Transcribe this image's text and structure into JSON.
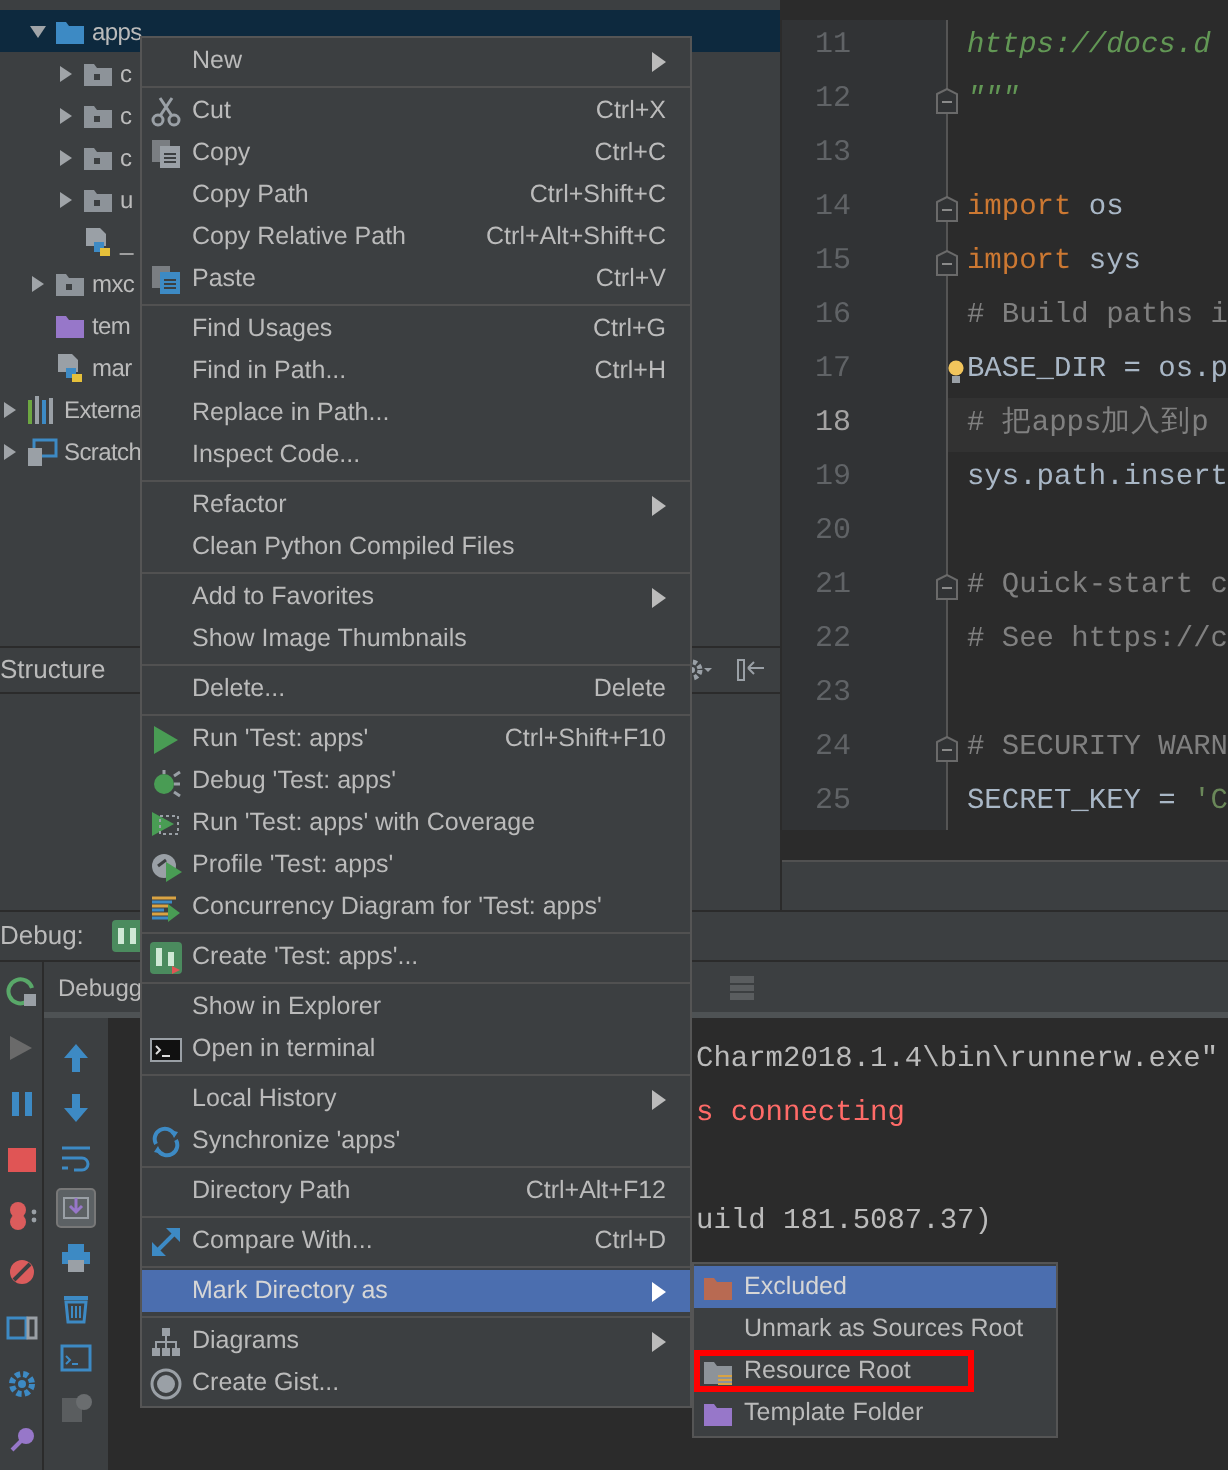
{
  "project_tree": {
    "items": [
      {
        "label": "apps",
        "kind": "source_folder",
        "expanded": true,
        "selected": true,
        "children": [
          {
            "label": "c",
            "kind": "folder",
            "expanded": false,
            "selected": false
          },
          {
            "label": "c",
            "kind": "folder",
            "expanded": false,
            "selected": false
          },
          {
            "label": "c",
            "kind": "folder",
            "expanded": false,
            "selected": false
          },
          {
            "label": "u",
            "kind": "folder",
            "expanded": false,
            "selected": false
          },
          {
            "label": "_",
            "kind": "python",
            "selected": false
          }
        ]
      },
      {
        "label": "mxc",
        "kind": "folder",
        "expanded": false,
        "selected": false
      },
      {
        "label": "tem",
        "kind": "template_folder",
        "selected": false
      },
      {
        "label": "mar",
        "kind": "python",
        "selected": false
      }
    ],
    "external_items": [
      {
        "label": "Externa",
        "kind": "library",
        "expanded": false,
        "selected": false
      },
      {
        "label": "Scratch",
        "kind": "scratch",
        "expanded": false,
        "selected": false
      }
    ]
  },
  "structure_panel": {
    "title": "Structure"
  },
  "editor": {
    "lines": [
      {
        "number": "11",
        "current": false,
        "fold_marker": false,
        "segments": [
          {
            "kind": "docstring",
            "text": "https://docs.d"
          }
        ]
      },
      {
        "number": "12",
        "current": false,
        "fold_marker": true,
        "segments": [
          {
            "kind": "docstring",
            "text": "\"\"\""
          }
        ]
      },
      {
        "number": "13",
        "current": false,
        "fold_marker": false
      },
      {
        "number": "14",
        "current": false,
        "fold_marker": true,
        "segments": [
          {
            "kind": "keyword",
            "text": "import "
          },
          {
            "kind": "plain",
            "text": "os"
          }
        ]
      },
      {
        "number": "15",
        "current": false,
        "fold_marker": true,
        "segments": [
          {
            "kind": "keyword",
            "text": "import "
          },
          {
            "kind": "plain",
            "text": "sys"
          }
        ]
      },
      {
        "number": "16",
        "current": false,
        "fold_marker": false,
        "segments": [
          {
            "kind": "comment",
            "text": "# Build paths i"
          }
        ]
      },
      {
        "number": "17",
        "current": false,
        "fold_marker": false,
        "segments": [
          {
            "kind": "plain",
            "text": "BASE_DIR = os.p"
          }
        ]
      },
      {
        "number": "18",
        "current": true,
        "fold_marker": false,
        "segments": [
          {
            "kind": "comment",
            "text": "# 把apps加入到p"
          }
        ]
      },
      {
        "number": "19",
        "current": false,
        "fold_marker": false,
        "segments": [
          {
            "kind": "plain",
            "text": "sys.path.insert"
          }
        ]
      },
      {
        "number": "20",
        "current": false,
        "fold_marker": false
      },
      {
        "number": "21",
        "current": false,
        "fold_marker": true,
        "segments": [
          {
            "kind": "comment",
            "text": "# Quick-start c"
          }
        ]
      },
      {
        "number": "22",
        "current": false,
        "fold_marker": false,
        "segments": [
          {
            "kind": "comment",
            "text": "# See https://c"
          }
        ]
      },
      {
        "number": "23",
        "current": false,
        "fold_marker": false
      },
      {
        "number": "24",
        "current": false,
        "fold_marker": true,
        "segments": [
          {
            "kind": "comment",
            "text": "# SECURITY WARN"
          }
        ]
      },
      {
        "number": "25",
        "current": false,
        "fold_marker": false,
        "segments": [
          {
            "kind": "plain",
            "text": "SECRET_KEY = "
          },
          {
            "kind": "string",
            "text": "'C"
          }
        ]
      }
    ]
  },
  "debug_panel": {
    "title": "Debug:",
    "tab": "Debugg",
    "console_lines": [
      {
        "kind": "plain",
        "text": "Charm2018.1.4\\bin\\runnerw.exe\""
      },
      {
        "kind": "error",
        "text": "s connecting"
      },
      {
        "kind": "blank"
      },
      {
        "kind": "plain",
        "text": "uild 181.5087.37)"
      }
    ]
  },
  "context_menu": {
    "items": [
      {
        "kind": "item",
        "label": "New",
        "submenu": true,
        "selected": false
      },
      {
        "kind": "separator"
      },
      {
        "kind": "item",
        "label": "Cut",
        "shortcut": "Ctrl+X",
        "submenu": false,
        "selected": false
      },
      {
        "kind": "item",
        "label": "Copy",
        "shortcut": "Ctrl+C",
        "submenu": false,
        "selected": false
      },
      {
        "kind": "item",
        "label": "Copy Path",
        "shortcut": "Ctrl+Shift+C",
        "submenu": false,
        "selected": false
      },
      {
        "kind": "item",
        "label": "Copy Relative Path",
        "shortcut": "Ctrl+Alt+Shift+C",
        "submenu": false,
        "selected": false
      },
      {
        "kind": "item",
        "label": "Paste",
        "shortcut": "Ctrl+V",
        "submenu": false,
        "selected": false
      },
      {
        "kind": "separator"
      },
      {
        "kind": "item",
        "label": "Find Usages",
        "shortcut": "Ctrl+G",
        "submenu": false,
        "selected": false
      },
      {
        "kind": "item",
        "label": "Find in Path...",
        "shortcut": "Ctrl+H",
        "submenu": false,
        "selected": false
      },
      {
        "kind": "item",
        "label": "Replace in Path...",
        "submenu": false,
        "selected": false
      },
      {
        "kind": "item",
        "label": "Inspect Code...",
        "submenu": false,
        "selected": false
      },
      {
        "kind": "separator"
      },
      {
        "kind": "item",
        "label": "Refactor",
        "submenu": true,
        "selected": false
      },
      {
        "kind": "item",
        "label": "Clean Python Compiled Files",
        "submenu": false,
        "selected": false
      },
      {
        "kind": "separator"
      },
      {
        "kind": "item",
        "label": "Add to Favorites",
        "submenu": true,
        "selected": false
      },
      {
        "kind": "item",
        "label": "Show Image Thumbnails",
        "submenu": false,
        "selected": false
      },
      {
        "kind": "separator"
      },
      {
        "kind": "item",
        "label": "Delete...",
        "shortcut": "Delete",
        "submenu": false,
        "selected": false
      },
      {
        "kind": "separator"
      },
      {
        "kind": "item",
        "label": "Run 'Test: apps'",
        "shortcut": "Ctrl+Shift+F10",
        "submenu": false,
        "selected": false
      },
      {
        "kind": "item",
        "label": "Debug 'Test: apps'",
        "submenu": false,
        "selected": false
      },
      {
        "kind": "item",
        "label": "Run 'Test: apps' with Coverage",
        "submenu": false,
        "selected": false
      },
      {
        "kind": "item",
        "label": "Profile 'Test: apps'",
        "submenu": false,
        "selected": false
      },
      {
        "kind": "item",
        "label": "Concurrency Diagram for 'Test: apps'",
        "submenu": false,
        "selected": false
      },
      {
        "kind": "separator"
      },
      {
        "kind": "item",
        "label": "Create 'Test: apps'...",
        "submenu": false,
        "selected": false
      },
      {
        "kind": "separator"
      },
      {
        "kind": "item",
        "label": "Show in Explorer",
        "submenu": false,
        "selected": false
      },
      {
        "kind": "item",
        "label": "Open in terminal",
        "submenu": false,
        "selected": false
      },
      {
        "kind": "separator"
      },
      {
        "kind": "item",
        "label": "Local History",
        "submenu": true,
        "selected": false
      },
      {
        "kind": "item",
        "label": "Synchronize 'apps'",
        "submenu": false,
        "selected": false
      },
      {
        "kind": "separator"
      },
      {
        "kind": "item",
        "label": "Directory Path",
        "shortcut": "Ctrl+Alt+F12",
        "submenu": false,
        "selected": false
      },
      {
        "kind": "separator"
      },
      {
        "kind": "item",
        "label": "Compare With...",
        "shortcut": "Ctrl+D",
        "submenu": false,
        "selected": false
      },
      {
        "kind": "separator"
      },
      {
        "kind": "item",
        "label": "Mark Directory as",
        "submenu": true,
        "selected": true
      },
      {
        "kind": "separator"
      },
      {
        "kind": "item",
        "label": "Diagrams",
        "submenu": true,
        "selected": false
      },
      {
        "kind": "item",
        "label": "Create Gist...",
        "submenu": false,
        "selected": false
      }
    ]
  },
  "submenu": {
    "items": [
      {
        "label": "Excluded",
        "selected": true
      },
      {
        "label": "Unmark as Sources Root",
        "selected": false
      },
      {
        "label": "Resource Root",
        "selected": false,
        "highlighted": true
      },
      {
        "label": "Template Folder",
        "selected": false
      }
    ]
  }
}
